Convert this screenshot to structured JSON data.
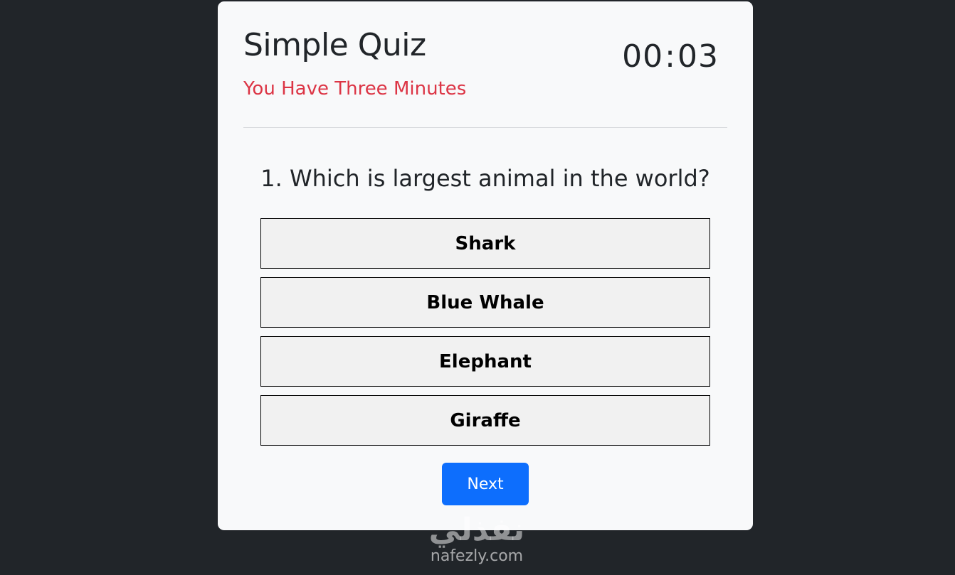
{
  "header": {
    "title": "Simple Quiz",
    "subtitle": "You Have Three Minutes",
    "timer": {
      "minutes": "00",
      "separator": ":",
      "seconds": "03"
    }
  },
  "question": {
    "text": "1. Which is largest animal in the world?",
    "answers": [
      {
        "label": "Shark"
      },
      {
        "label": "Blue Whale"
      },
      {
        "label": "Elephant"
      },
      {
        "label": "Giraffe"
      }
    ]
  },
  "actions": {
    "next_label": "Next"
  },
  "watermark": {
    "logo": "نفذلي",
    "url": "nafezly.com"
  },
  "colors": {
    "page_background": "#212529",
    "card_background": "#f8f9fa",
    "subtitle_red": "#dc3545",
    "next_button_blue": "#0d6efd",
    "answer_background": "#f1f1f1"
  }
}
